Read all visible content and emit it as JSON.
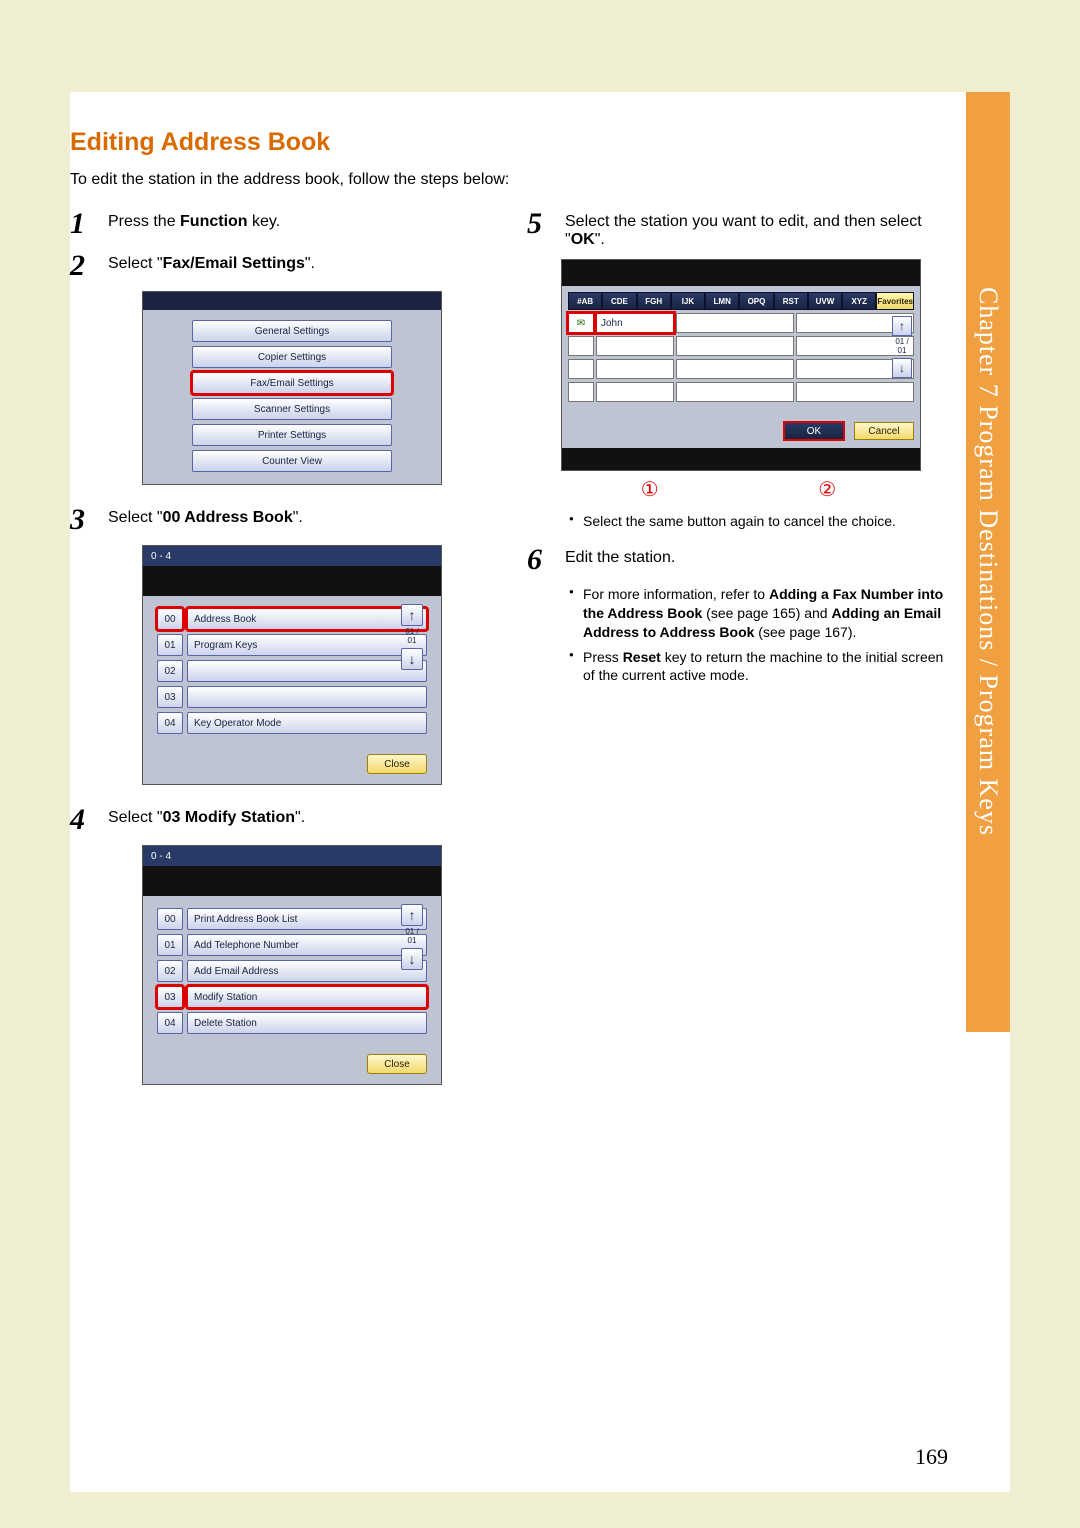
{
  "chapter_tab": "Chapter 7  Program Destinations / Program Keys",
  "section_title": "Editing Address Book",
  "lead": "To edit the station in the address book, follow the steps below:",
  "steps_left": {
    "s1": {
      "pre": "Press the ",
      "bold": "Function",
      "post": " key."
    },
    "s2": {
      "pre": "Select \"",
      "bold": "Fax/Email Settings",
      "post": "\"."
    },
    "s3": {
      "pre": "Select \"",
      "bold": "00 Address Book",
      "post": "\"."
    },
    "s4": {
      "pre": "Select \"",
      "bold": "03 Modify Station",
      "post": "\"."
    }
  },
  "steps_right": {
    "s5": {
      "pre": "Select the station you want to edit, and then select \"",
      "bold": "OK",
      "post": "\"."
    },
    "s6": {
      "pre": "Edit the station.",
      "bold": "",
      "post": ""
    }
  },
  "panel1_buttons": [
    "General Settings",
    "Copier Settings",
    "Fax/Email Settings",
    "Scanner Settings",
    "Printer Settings",
    "Counter View"
  ],
  "panel2": {
    "header": "0  - 4",
    "rows": [
      {
        "num": "00",
        "label": "Address Book"
      },
      {
        "num": "01",
        "label": "Program Keys"
      },
      {
        "num": "02",
        "label": ""
      },
      {
        "num": "03",
        "label": ""
      },
      {
        "num": "04",
        "label": "Key Operator Mode"
      }
    ],
    "close": "Close",
    "page_ind": "01\n/\n01"
  },
  "panel3": {
    "header": "0  - 4",
    "rows": [
      {
        "num": "00",
        "label": "Print Address Book List"
      },
      {
        "num": "01",
        "label": "Add Telephone Number"
      },
      {
        "num": "02",
        "label": "Add Email Address"
      },
      {
        "num": "03",
        "label": "Modify Station"
      },
      {
        "num": "04",
        "label": "Delete Station"
      }
    ],
    "close": "Close",
    "page_ind": "01\n/\n01"
  },
  "abpanel": {
    "tabs": [
      "#AB",
      "CDE",
      "FGH",
      "IJK",
      "LMN",
      "OPQ",
      "RST",
      "UVW",
      "XYZ",
      "Favorites"
    ],
    "first_cell_icon": "✉",
    "first_cell_name": "John",
    "ok": "OK",
    "cancel": "Cancel",
    "page_ind": "01\n/\n01"
  },
  "callout1": "①",
  "callout2": "②",
  "bullet5": "Select the same button again to cancel the choice.",
  "bullets6": [
    {
      "pre": "For more information, refer to ",
      "b1": "Adding a Fax Number into the Address Book",
      "mid": " (see page 165) and ",
      "b2": "Adding an Email Address to Address Book",
      "post": " (see page 167)."
    },
    {
      "pre": "Press ",
      "b1": "Reset",
      "mid": " key to return the machine to the initial screen of the current active mode.",
      "b2": "",
      "post": ""
    }
  ],
  "page_number": "169"
}
